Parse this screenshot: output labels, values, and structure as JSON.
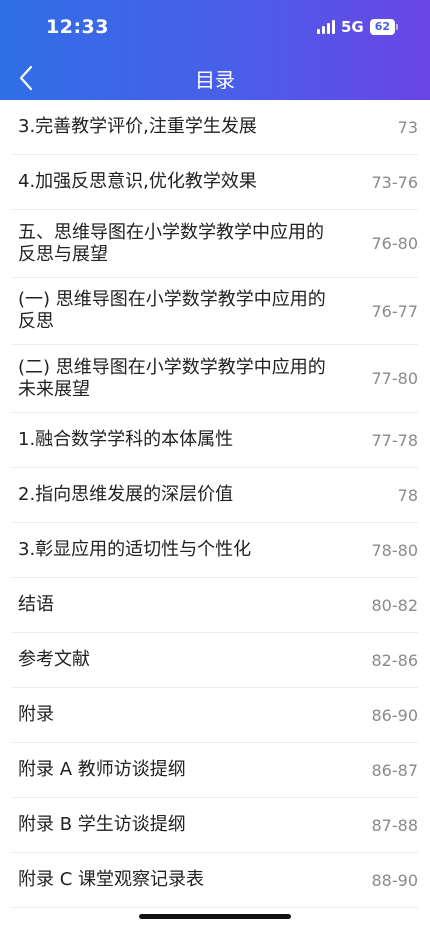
{
  "status": {
    "time": "12:33",
    "network": "5G",
    "battery": "62"
  },
  "nav": {
    "title": "目录"
  },
  "toc": [
    {
      "label": "3.完善教学评价,注重学生发展",
      "pages": "73"
    },
    {
      "label": "4.加强反思意识,优化教学效果",
      "pages": "73-76"
    },
    {
      "label": "五、思维导图在小学数学教学中应用的反思与展望",
      "pages": "76-80"
    },
    {
      "label": "(一) 思维导图在小学数学教学中应用的反思",
      "pages": "76-77"
    },
    {
      "label": "(二) 思维导图在小学数学教学中应用的未来展望",
      "pages": "77-80"
    },
    {
      "label": "1.融合数学学科的本体属性",
      "pages": "77-78"
    },
    {
      "label": "2.指向思维发展的深层价值",
      "pages": "78"
    },
    {
      "label": "3.彰显应用的适切性与个性化",
      "pages": "78-80"
    },
    {
      "label": "结语",
      "pages": "80-82"
    },
    {
      "label": "参考文献",
      "pages": "82-86"
    },
    {
      "label": "附录",
      "pages": "86-90"
    },
    {
      "label": "附录 A 教师访谈提纲",
      "pages": "86-87"
    },
    {
      "label": "附录 B 学生访谈提纲",
      "pages": "87-88"
    },
    {
      "label": "附录 C 课堂观察记录表",
      "pages": "88-90"
    }
  ],
  "icons": {
    "back": "chevron-left-icon",
    "signal": "signal-icon",
    "battery": "battery-icon"
  },
  "colors": {
    "header_start": "#2f6fe6",
    "header_end": "#6a45e6",
    "page_number": "#8a8a8a"
  }
}
